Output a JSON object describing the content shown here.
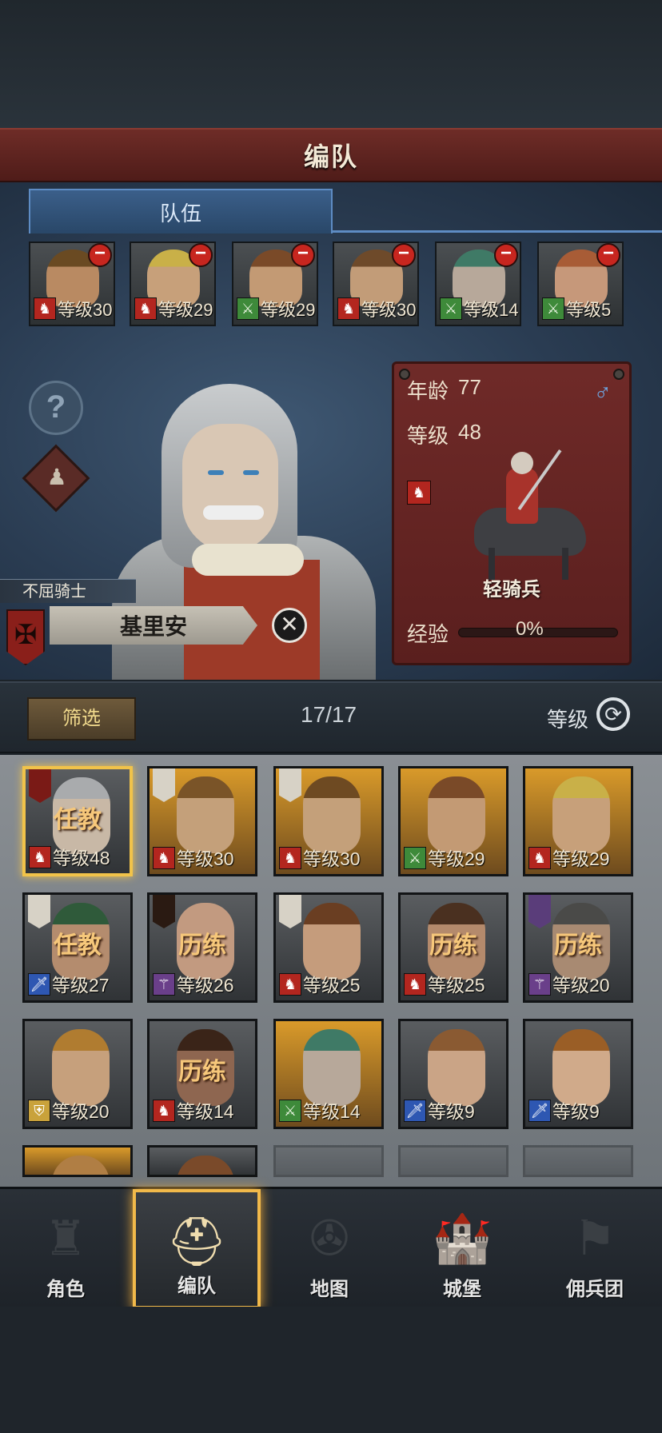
{
  "header": {
    "title": "编队"
  },
  "tabs": {
    "active": "队伍"
  },
  "team": [
    {
      "cls_icon": "horse-icon",
      "cls_color": "red",
      "level": "等级30",
      "skin": "#b98a62",
      "hair": "#6a4a22"
    },
    {
      "cls_icon": "horse-icon",
      "cls_color": "red",
      "level": "等级29",
      "skin": "#c7a07a",
      "hair": "#c9b048"
    },
    {
      "cls_icon": "crossed-swords-icon",
      "cls_color": "green",
      "level": "等级29",
      "skin": "#c39a74",
      "hair": "#7a4a28"
    },
    {
      "cls_icon": "horse-icon",
      "cls_color": "red",
      "level": "等级30",
      "skin": "#c29c78",
      "hair": "#6e4a2a"
    },
    {
      "cls_icon": "crossed-swords-icon",
      "cls_color": "green",
      "level": "等级14",
      "skin": "#b7a89a",
      "hair": "#3f7a66"
    },
    {
      "cls_icon": "crossed-swords-icon",
      "cls_color": "green",
      "level": "等级5",
      "skin": "#c6987a",
      "hair": "#a85c36"
    }
  ],
  "hero": {
    "title": "不屈骑士",
    "name": "基里安",
    "age_label": "年龄",
    "age": "77",
    "level_label": "等级",
    "level": "48",
    "unit": "轻骑兵",
    "exp_label": "经验",
    "exp_value": "0%",
    "exp_fraction": 0,
    "gender_icon": "male-icon",
    "help_icon": "question-icon"
  },
  "filter": {
    "button": "筛选",
    "count": "17/17",
    "sort_label": "等级"
  },
  "roster": [
    {
      "status": "任教",
      "level": "等级48",
      "cls_color": "red",
      "frame": "gray",
      "banner": "redc",
      "selected": true,
      "skin": "#c8b8a6",
      "hair": "#a9abad"
    },
    {
      "status": "",
      "level": "等级30",
      "cls_color": "red",
      "frame": "gold",
      "banner": "light",
      "skin": "#c4a07a",
      "hair": "#7a5428"
    },
    {
      "status": "",
      "level": "等级30",
      "cls_color": "red",
      "frame": "gold",
      "banner": "light",
      "skin": "#c4a07a",
      "hair": "#6e4a22"
    },
    {
      "status": "",
      "level": "等级29",
      "cls_color": "green",
      "frame": "gold",
      "banner": "",
      "skin": "#c39a74",
      "hair": "#7a4a28"
    },
    {
      "status": "",
      "level": "等级29",
      "cls_color": "red",
      "frame": "gold",
      "banner": "",
      "skin": "#c7a07a",
      "hair": "#c9b048"
    },
    {
      "status": "任教",
      "level": "等级27",
      "cls_color": "blue",
      "frame": "gray",
      "banner": "light",
      "skin": "#b48c6e",
      "hair": "#2f5a3a"
    },
    {
      "status": "历练",
      "level": "等级26",
      "cls_color": "purple",
      "frame": "gray",
      "banner": "dark",
      "skin": "#c29a80",
      "hair": "#c29a80"
    },
    {
      "status": "",
      "level": "等级25",
      "cls_color": "red",
      "frame": "gray",
      "banner": "light",
      "skin": "#c59c7c",
      "hair": "#6a3e22"
    },
    {
      "status": "历练",
      "level": "等级25",
      "cls_color": "red",
      "frame": "gray",
      "banner": "",
      "skin": "#b48a6c",
      "hair": "#4a3020"
    },
    {
      "status": "历练",
      "level": "等级20",
      "cls_color": "purple",
      "frame": "gray",
      "banner": "purple",
      "skin": "#a88a72",
      "hair": "#4a4a48"
    },
    {
      "status": "",
      "level": "等级20",
      "cls_color": "yellow",
      "frame": "gray",
      "banner": "",
      "skin": "#c6a07c",
      "hair": "#b07c30"
    },
    {
      "status": "历练",
      "level": "等级14",
      "cls_color": "red",
      "frame": "gray",
      "banner": "",
      "skin": "#8e6650",
      "hair": "#3a2418"
    },
    {
      "status": "",
      "level": "等级14",
      "cls_color": "green",
      "frame": "gold",
      "banner": "",
      "skin": "#b7a89a",
      "hair": "#3f7a66"
    },
    {
      "status": "",
      "level": "等级9",
      "cls_color": "blue",
      "frame": "gray",
      "banner": "",
      "skin": "#caa486",
      "hair": "#8a5a32"
    },
    {
      "status": "",
      "level": "等级9",
      "cls_color": "blue",
      "frame": "gray",
      "banner": "",
      "skin": "#d0aa8a",
      "hair": "#9a5e26"
    },
    {
      "status": "",
      "level": "",
      "cls_color": "",
      "frame": "gold",
      "banner": "",
      "skin": "#c49a72",
      "hair": "#b07e44"
    },
    {
      "status": "",
      "level": "",
      "cls_color": "",
      "frame": "gray",
      "banner": "",
      "skin": "#c49a72",
      "hair": "#7a4a2a"
    }
  ],
  "nav": [
    {
      "label": "角色",
      "icon": "knight-icon",
      "active": false
    },
    {
      "label": "编队",
      "icon": "helmet-icon",
      "active": true
    },
    {
      "label": "地图",
      "icon": "compass-icon",
      "active": false
    },
    {
      "label": "城堡",
      "icon": "castle-icon",
      "active": false
    },
    {
      "label": "佣兵团",
      "icon": "banner-icon",
      "active": false
    }
  ]
}
